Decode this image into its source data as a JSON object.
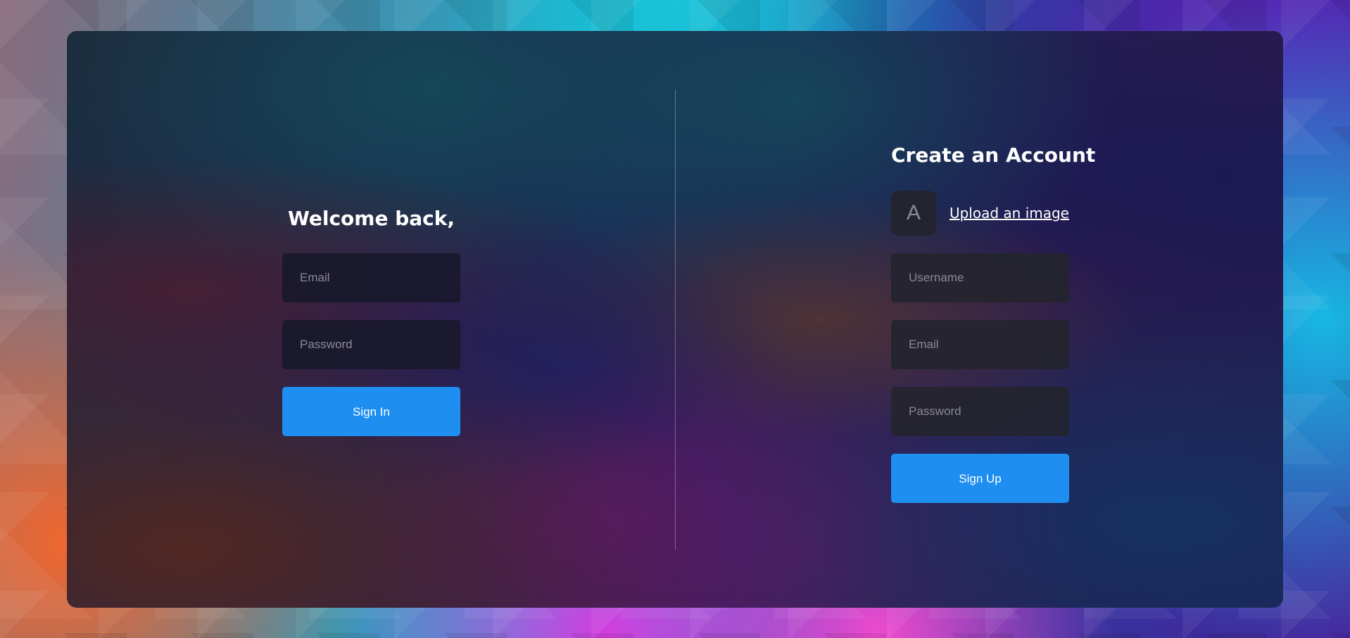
{
  "sign_in": {
    "title": "Welcome back,",
    "email_placeholder": "Email",
    "password_placeholder": "Password",
    "button_label": "Sign In"
  },
  "sign_up": {
    "title": "Create an Account",
    "avatar_initial": "A",
    "upload_link": "Upload an image",
    "username_placeholder": "Username",
    "email_placeholder": "Email",
    "password_placeholder": "Password",
    "button_label": "Sign Up"
  },
  "colors": {
    "accent": "#1f8ef1",
    "input_background": "#24242e",
    "placeholder_text": "#8a8a94"
  }
}
